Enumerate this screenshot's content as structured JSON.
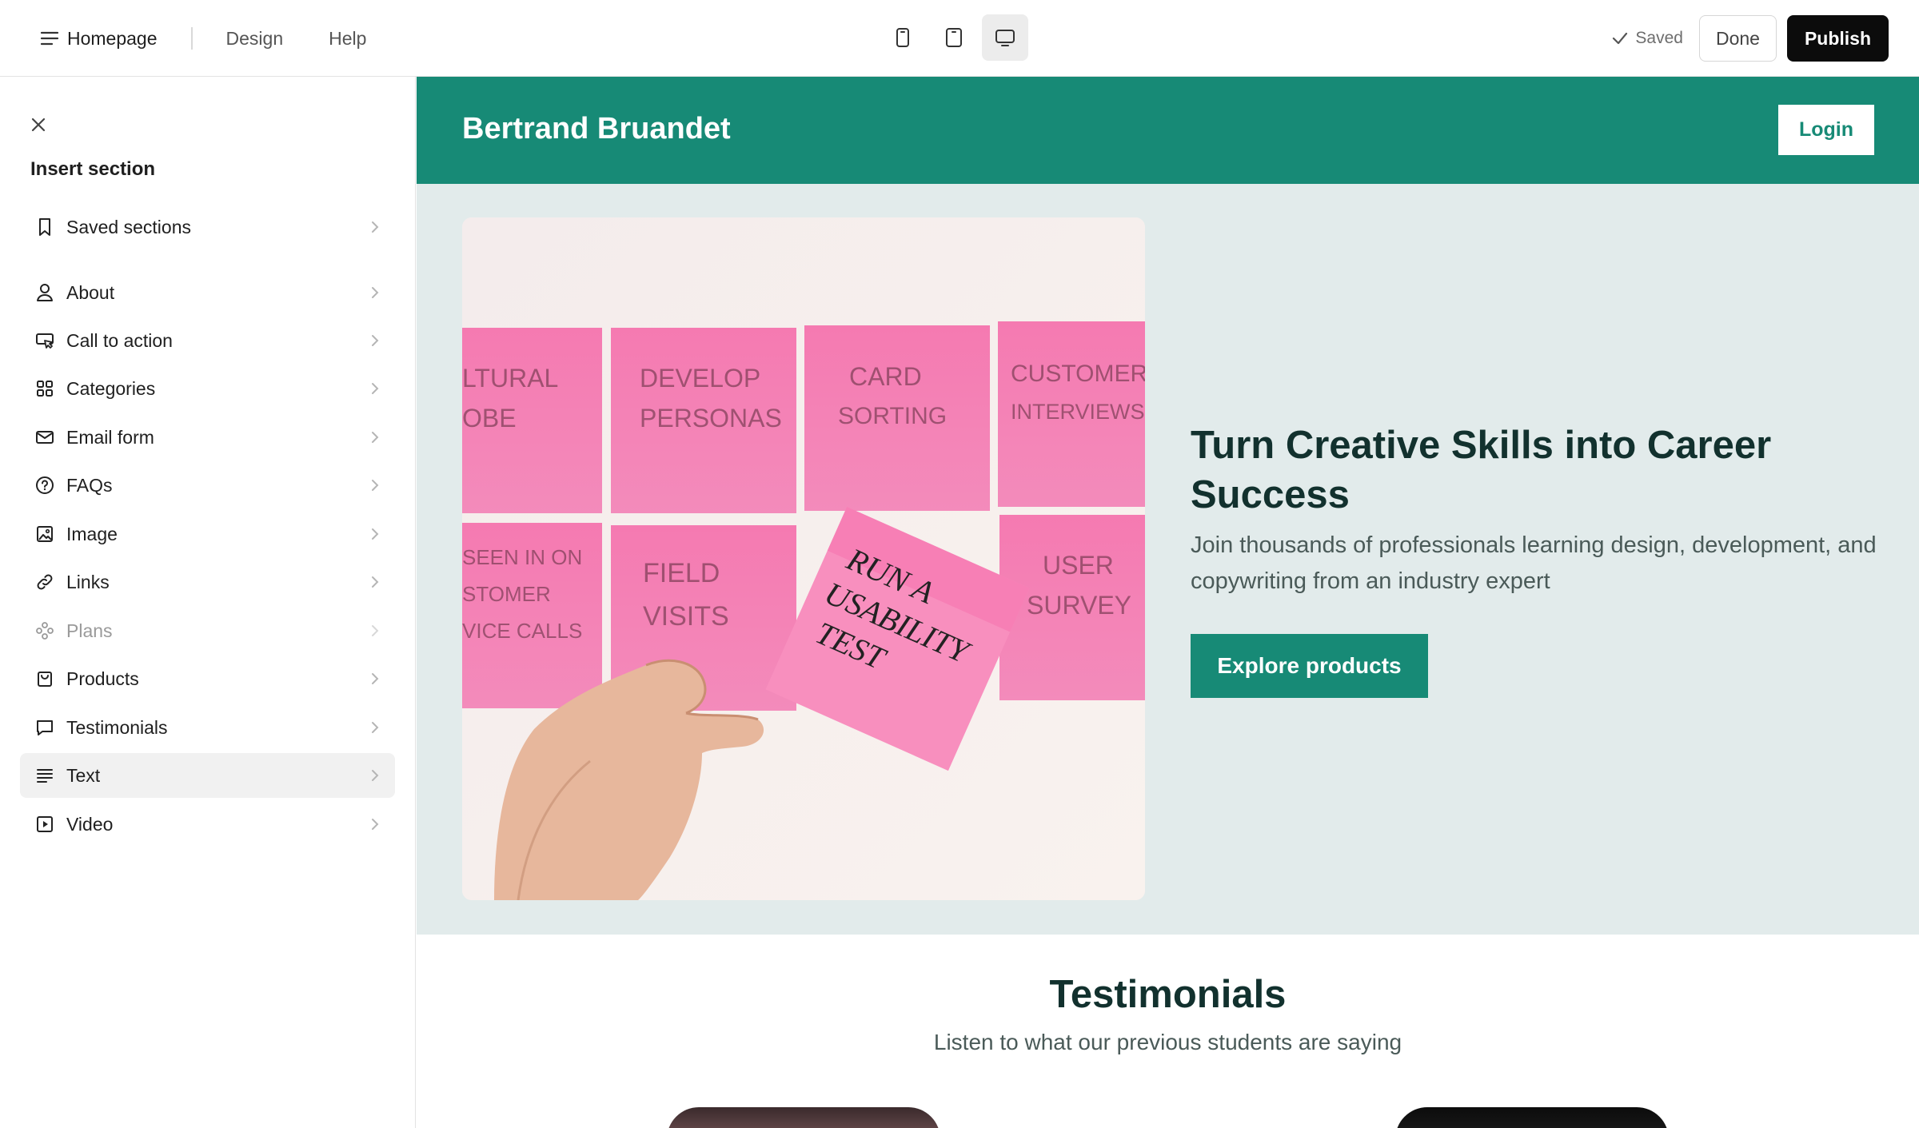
{
  "topbar": {
    "page_label": "Homepage",
    "nav": [
      "Design",
      "Help"
    ],
    "devices": [
      "phone-icon",
      "tablet-icon",
      "desktop-icon"
    ],
    "active_device": "desktop",
    "saved_label": "Saved",
    "done_label": "Done",
    "publish_label": "Publish"
  },
  "sidebar": {
    "title": "Insert section",
    "saved_sections": {
      "label": "Saved sections",
      "icon": "bookmark-icon"
    },
    "items": [
      {
        "label": "About",
        "icon": "person-icon"
      },
      {
        "label": "Call to action",
        "icon": "pointer-sign-icon"
      },
      {
        "label": "Categories",
        "icon": "grid-icon"
      },
      {
        "label": "Email form",
        "icon": "envelope-icon"
      },
      {
        "label": "FAQs",
        "icon": "question-circle-icon"
      },
      {
        "label": "Image",
        "icon": "image-icon"
      },
      {
        "label": "Links",
        "icon": "link-icon"
      },
      {
        "label": "Plans",
        "icon": "plans-icon",
        "disabled": true
      },
      {
        "label": "Products",
        "icon": "bag-icon"
      },
      {
        "label": "Testimonials",
        "icon": "speech-bubble-icon"
      },
      {
        "label": "Text",
        "icon": "text-lines-icon",
        "active": true
      },
      {
        "label": "Video",
        "icon": "play-square-icon"
      }
    ]
  },
  "preview": {
    "site_name": "Bertrand Bruandet",
    "login_label": "Login",
    "hero": {
      "title": "Turn Creative Skills into Career Success",
      "subtitle": "Join thousands of professionals learning design, development, and copywriting from an industry expert",
      "cta_label": "Explore products",
      "image_notes": [
        "LTURAL",
        "OBE",
        "DEVELOP",
        "PERSONAS",
        "CARD",
        "SORTING",
        "CUSTOMER",
        "INTERVIEWS",
        "SEEN IN ON",
        "STOMER",
        "VICE CALLS",
        "FIELD",
        "VISITS",
        "RUN A",
        "USABILITY",
        "TEST",
        "USER",
        "SURVEY"
      ]
    },
    "testimonials": {
      "title": "Testimonials",
      "subtitle": "Listen to what our previous students are saying"
    }
  },
  "colors": {
    "brand_teal": "#178a76",
    "hero_bg": "#e2ebeb",
    "heading_text": "#12312e",
    "publish_bg": "#0c0c0c",
    "sticky_note_pink": "#f97bb3"
  }
}
